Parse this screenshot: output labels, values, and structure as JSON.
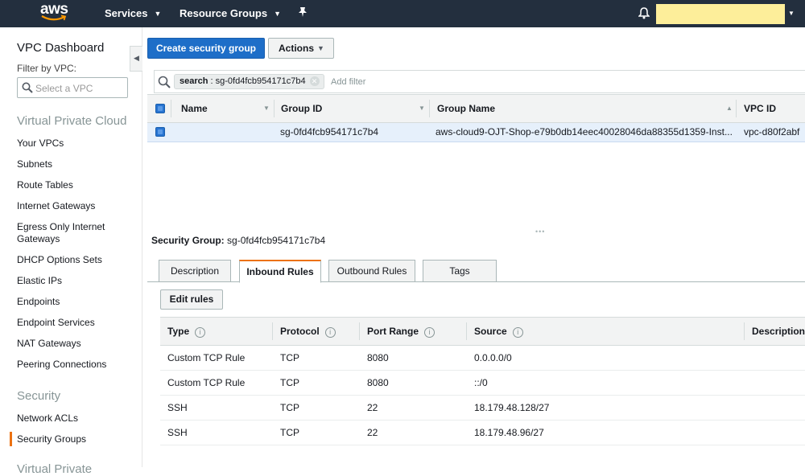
{
  "topbar": {
    "logo": "aws",
    "services": "Services",
    "resource_groups": "Resource Groups",
    "pin_icon": "pin-icon",
    "bell_icon": "bell-icon",
    "account_color": "#fdee9a"
  },
  "sidebar": {
    "title": "VPC Dashboard",
    "filter_label": "Filter by VPC:",
    "filter_placeholder": "Select a VPC",
    "section_vpc": "Virtual Private Cloud",
    "vpc_items": [
      "Your VPCs",
      "Subnets",
      "Route Tables",
      "Internet Gateways",
      "Egress Only Internet Gateways",
      "DHCP Options Sets",
      "Elastic IPs",
      "Endpoints",
      "Endpoint Services",
      "NAT Gateways",
      "Peering Connections"
    ],
    "section_security": "Security",
    "security_items": [
      "Network ACLs",
      "Security Groups"
    ],
    "active_item": "Security Groups",
    "section_vpn": "Virtual Private"
  },
  "toolbar": {
    "create_label": "Create security group",
    "actions_label": "Actions"
  },
  "filter": {
    "token_key": "search",
    "token_value": " : sg-0fd4fcb954171c7b4",
    "add_placeholder": "Add filter"
  },
  "grid": {
    "columns": [
      "Name",
      "Group ID",
      "Group Name",
      "VPC ID"
    ],
    "rows": [
      {
        "name": "",
        "group_id": "sg-0fd4fcb954171c7b4",
        "group_name": "aws-cloud9-OJT-Shop-e79b0db14eec40028046da88355d1359-Inst...",
        "vpc_id": "vpc-d80f2abf"
      }
    ]
  },
  "details": {
    "label": "Security Group:",
    "value": " sg-0fd4fcb954171c7b4",
    "tabs": [
      "Description",
      "Inbound Rules",
      "Outbound Rules",
      "Tags"
    ],
    "active_tab": "Inbound Rules",
    "edit_label": "Edit rules"
  },
  "rules": {
    "columns": [
      "Type",
      "Protocol",
      "Port Range",
      "Source",
      "Description"
    ],
    "rows": [
      {
        "type": "Custom TCP Rule",
        "protocol": "TCP",
        "port": "8080",
        "source": "0.0.0.0/0"
      },
      {
        "type": "Custom TCP Rule",
        "protocol": "TCP",
        "port": "8080",
        "source": "::/0"
      },
      {
        "type": "SSH",
        "protocol": "TCP",
        "port": "22",
        "source": "18.179.48.128/27"
      },
      {
        "type": "SSH",
        "protocol": "TCP",
        "port": "22",
        "source": "18.179.48.96/27"
      }
    ]
  },
  "colors": {
    "topbar": "#232f3e",
    "primary": "#1e6ec8",
    "accent": "#ec7211"
  }
}
